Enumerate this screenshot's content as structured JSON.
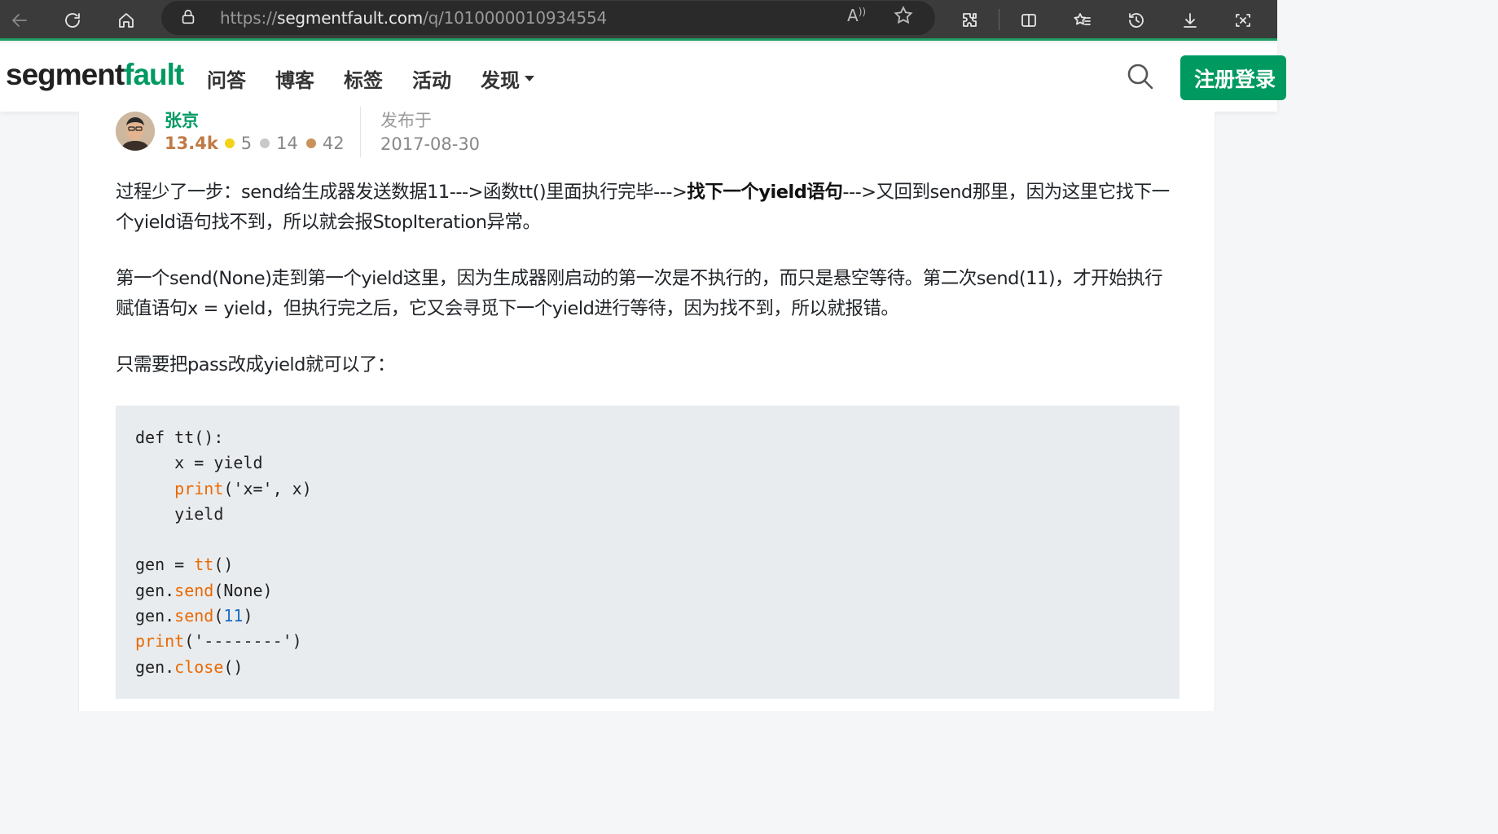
{
  "browser": {
    "url_proto": "https://",
    "url_host": "segmentfault.com",
    "url_path": "/q/1010000010934554",
    "read_aloud": "A",
    "icons": [
      "back-icon",
      "refresh-icon",
      "home-icon",
      "lock-icon",
      "read-aloud-icon",
      "favorite-star-icon",
      "extensions-icon",
      "split-screen-icon",
      "favorites-icon",
      "history-icon",
      "download-icon",
      "screenshot-icon"
    ]
  },
  "header": {
    "logo_part1": "segment",
    "logo_part2": "fault",
    "nav": [
      "问答",
      "博客",
      "标签",
      "活动",
      "发现"
    ],
    "login": "注册登录",
    "accent": "#009a61"
  },
  "answer": {
    "author": "张京",
    "reputation": "13.4k",
    "gold": "5",
    "silver": "14",
    "bronze": "42",
    "published_label": "发布于",
    "published_date": "2017-08-30",
    "p1_a": "过程少了一步：send给生成器发送数据11--->函数tt()里面执行完毕--->",
    "p1_bold": "找下一个yield语句",
    "p1_b": "--->又回到send那里，因为这里它找下一个yield语句找不到，所以就会报StopIteration异常。",
    "p2": "第一个send(None)走到第一个yield这里，因为生成器刚启动的第一次是不执行的，而只是悬空等待。第二次send(11)，才开始执行赋值语句x = yield，但执行完之后，它又会寻觅下一个yield进行等待，因为找不到，所以就报错。",
    "p3": "只需要把pass改成yield就可以了：",
    "code": {
      "l1": "def tt():",
      "l2": "    x = yield",
      "l3_indent": "    ",
      "l3_fn": "print",
      "l3_rest": "('x=', x)",
      "l4": "    yield",
      "l6_a": "gen = ",
      "l6_fn": "tt",
      "l6_b": "()",
      "l7_a": "gen.",
      "l7_fn": "send",
      "l7_b": "(None)",
      "l8_a": "gen.",
      "l8_fn": "send",
      "l8_p1": "(",
      "l8_num": "11",
      "l8_p2": ")",
      "l9_fn": "print",
      "l9_rest": "('--------')",
      "l10_a": "gen.",
      "l10_fn": "close",
      "l10_b": "()"
    }
  }
}
